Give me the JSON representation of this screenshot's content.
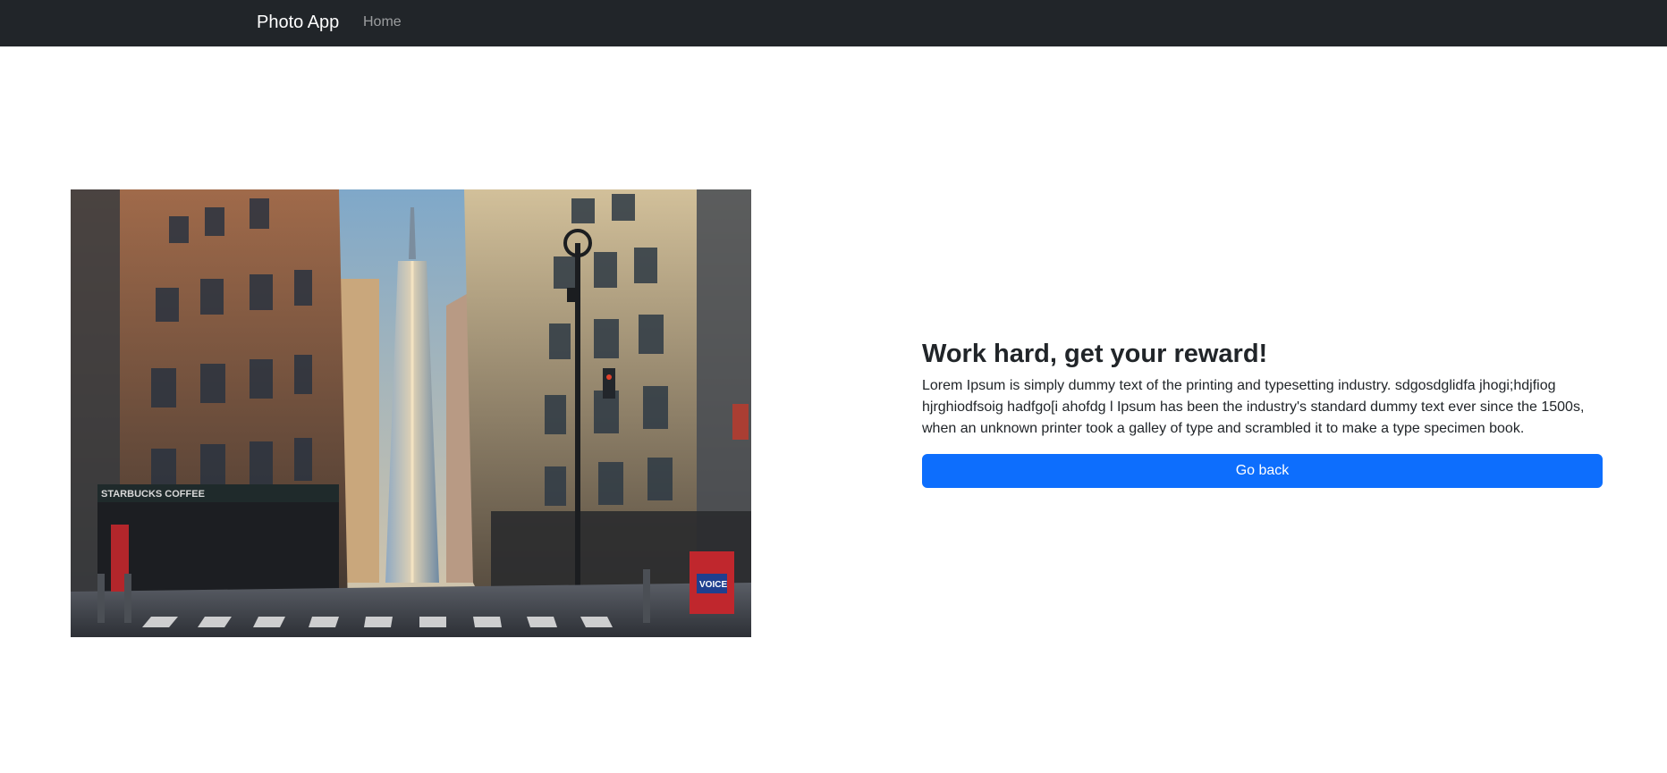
{
  "navbar": {
    "brand": "Photo App",
    "links": [
      {
        "label": "Home"
      }
    ],
    "background": "#212529"
  },
  "photo": {
    "description": "city-street-skyscraper-photo",
    "storefront_sign": "STARBUCKS COFFEE",
    "newsbox_sign": "VOICE"
  },
  "main": {
    "heading": "Work hard, get your reward!",
    "body": "Lorem Ipsum is simply dummy text of the printing and typesetting industry. sdgosdglidfa jhogi;hdjfiog hjrghiodfsoig hadfgo[i ahofdg l Ipsum has been the industry's standard dummy text ever since the 1500s, when an unknown printer took a galley of type and scrambled it to make a type specimen book.",
    "button_label": "Go back",
    "button_color": "#0d6efd"
  }
}
